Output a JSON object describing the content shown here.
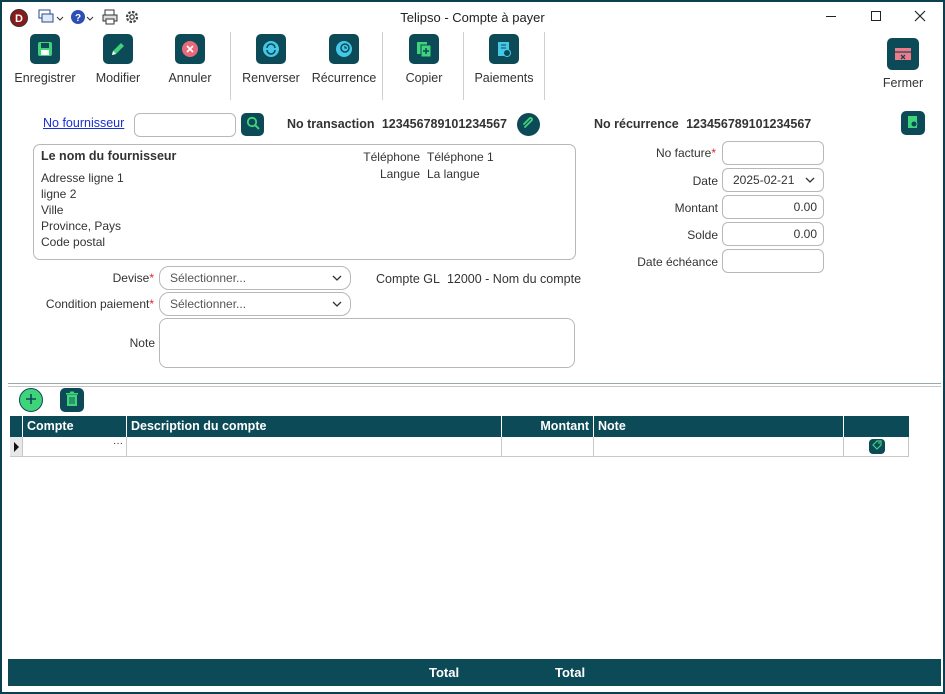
{
  "window": {
    "title": "Telipso - Compte à payer",
    "logo_letter": "D",
    "controls": [
      "minimize",
      "maximize",
      "close"
    ]
  },
  "quick_access": [
    "windows-icon",
    "help-icon",
    "print-icon",
    "settings-icon"
  ],
  "toolbar": {
    "save": "Enregistrer",
    "edit": "Modifier",
    "cancel": "Annuler",
    "reverse": "Renverser",
    "recurrence": "Récurrence",
    "copy": "Copier",
    "payments": "Paiements",
    "close": "Fermer"
  },
  "supplier": {
    "link_label": "No fournisseur",
    "input_value": "",
    "name": "Le nom du fournisseur",
    "address_lines": [
      "Adresse ligne 1",
      "ligne 2",
      "Ville",
      "Province, Pays",
      "Code postal"
    ],
    "phone_label": "Téléphone",
    "phone_value": "Téléphone 1",
    "language_label": "Langue",
    "language_value": "La langue"
  },
  "transaction": {
    "label": "No transaction",
    "value": "123456789101234567"
  },
  "recurrence": {
    "label": "No récurrence",
    "value": "123456789101234567"
  },
  "invoice": {
    "invoice_label": "No facture",
    "invoice_value": "",
    "date_label": "Date",
    "date_value": "2025-02-21",
    "amount_label": "Montant",
    "amount_value": "0.00",
    "balance_label": "Solde",
    "balance_value": "0.00",
    "due_label": "Date échéance",
    "due_value": ""
  },
  "currency": {
    "label": "Devise",
    "placeholder": "Sélectionner..."
  },
  "payment_condition": {
    "label": "Condition paiement",
    "placeholder": "Sélectionner..."
  },
  "gl_account": {
    "label": "Compte GL",
    "value": "12000 - Nom du compte"
  },
  "note": {
    "label": "Note",
    "value": ""
  },
  "grid": {
    "columns": [
      "Compte",
      "Description du compte",
      "Montant",
      "Note"
    ],
    "rows": [
      {
        "compte": "",
        "ellipsis": "···",
        "description": "",
        "montant": "",
        "note": ""
      }
    ]
  },
  "footer": {
    "total_1": "Total",
    "total_2": "Total"
  },
  "colors": {
    "accent": "#0c4a58",
    "required": "#dd2233",
    "link": "#1a2fd0"
  }
}
